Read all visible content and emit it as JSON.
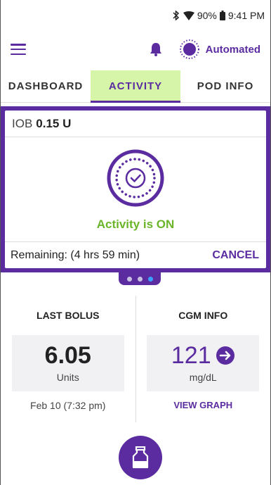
{
  "status_bar": {
    "battery": "90%",
    "time": "9:41 PM",
    "icons": [
      "bluetooth-icon",
      "wifi-icon",
      "battery-icon"
    ]
  },
  "app_bar": {
    "menu_icon": "menu-icon",
    "notification_icon": "bell-icon",
    "mode_label": "Automated"
  },
  "tabs": [
    {
      "label": "DASHBOARD",
      "active": false
    },
    {
      "label": "ACTIVITY",
      "active": true
    },
    {
      "label": "POD INFO",
      "active": false
    }
  ],
  "activity": {
    "iob_label": "IOB",
    "iob_value": "0.15 U",
    "status": "Activity is ON",
    "remaining": "Remaining: (4 hrs 59 min)",
    "cancel_label": "CANCEL"
  },
  "pager": {
    "count": 3,
    "active_index": 2
  },
  "last_bolus": {
    "title": "LAST BOLUS",
    "value": "6.05",
    "unit": "Units",
    "date": "Feb 10 (7:32 pm)"
  },
  "cgm": {
    "title": "CGM INFO",
    "value": "121",
    "unit": "mg/dL",
    "link": "VIEW GRAPH"
  },
  "colors": {
    "brand": "#5a2ca0",
    "active_tab_bg": "#d6f5a8",
    "status_green": "#6bb52b",
    "page_dot_active": "#3aa0ff"
  }
}
